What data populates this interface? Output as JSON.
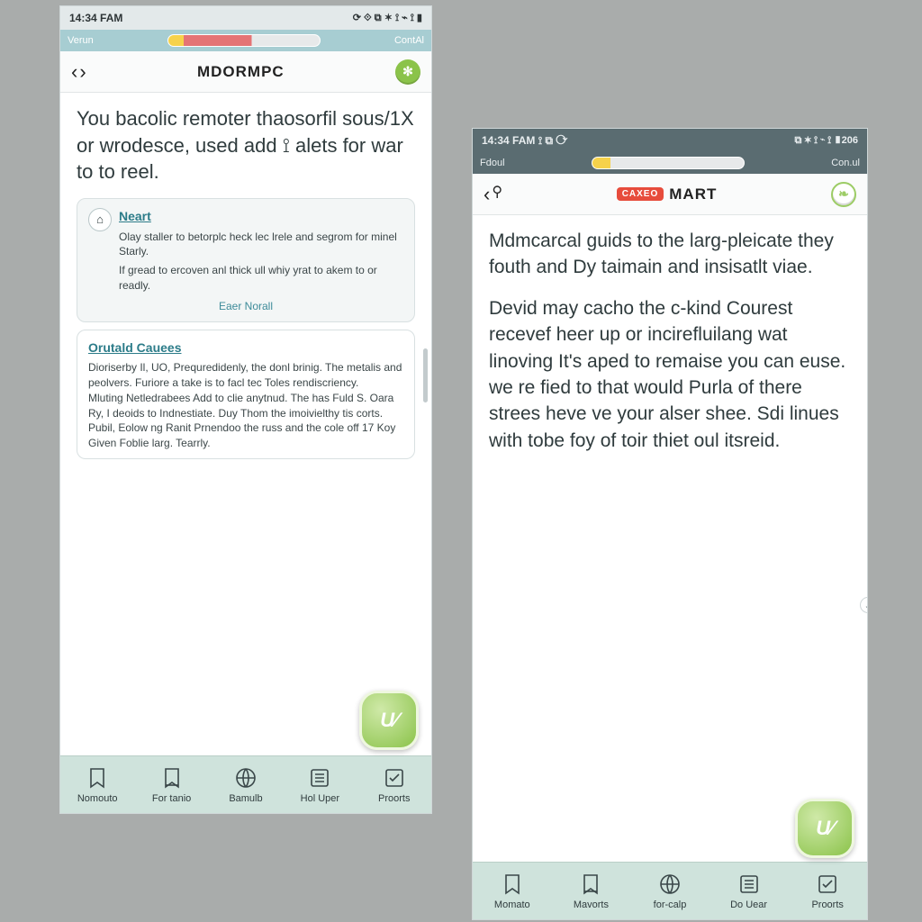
{
  "left": {
    "status": {
      "time": "14:34  FAM",
      "icons": "⟳ ⟐    ⧉ ✶ ⟟ ⌁ ⟟ ▮"
    },
    "strip": {
      "left": "Verun",
      "right": "ContAl"
    },
    "nav": {
      "title": "MDORMPC",
      "badge_glyph": "✻"
    },
    "lead": "You bacolic remoter thaosorfil sous/1X or wrodesce, used add ⟟ alets for war to to reel.",
    "card1": {
      "icon": "⌂",
      "title": "Neart",
      "line1": "Olay staller to betorplc heck lec lrele and segrom for minel Starly.",
      "line2": "If gread to ercoven anl thick ull whiy yrat to akem to or readly.",
      "footer": "Eaer Norall"
    },
    "card2": {
      "title": "Orutald Cauees",
      "body": "Dioriserby Il, UO, Prequredidenly, the donl brinig. The metalis and peolvers. Furiore a take is to facl tec Toles rendiscriency.\nMluting Netledrabees Add to clie anytnud. The has Fuld S. Oara Ry, I deoids to Indnestiate. Duy Thom the imoivielthy tis corts.\nPubil, Eolow ng Ranit Prnendoo the russ and the cole off 17 Koy Given Foblie larg. Tearrly."
    },
    "tabs": [
      "Nomouto",
      "For tanio",
      "Bamulb",
      "Hol Uper",
      "Proorts"
    ]
  },
  "right": {
    "status": {
      "time": "14:34  FAM ⟟ ⧉ ⟳",
      "icons": "⧉ ✶ ⟟ ⌁ ⟟ ▮206"
    },
    "strip": {
      "left": "Fdoul",
      "right": "Con.ul"
    },
    "nav": {
      "badge": "CAXEO",
      "title": "MART"
    },
    "para1": "Mdmcarcal guids to the larg-pleicate they fouth and Dy taimain and insisatlt viae.",
    "para2": "Devid may cacho the c-kind Courest recevef heer up or incirefluilang wat linoving It's aped to remaise you can euse. we re fied to that would Purla of there strees heve ve your alser shee. Sdi linues with tobe foy of toir thiet oul itsreid.",
    "tabs": [
      "Momato",
      "Mavorts",
      "for-calp",
      "Do Uear",
      "Proorts"
    ]
  },
  "tab_icons": [
    "bookmark",
    "bookmark",
    "globe",
    "list",
    "check"
  ],
  "fab_text": "U⁄"
}
